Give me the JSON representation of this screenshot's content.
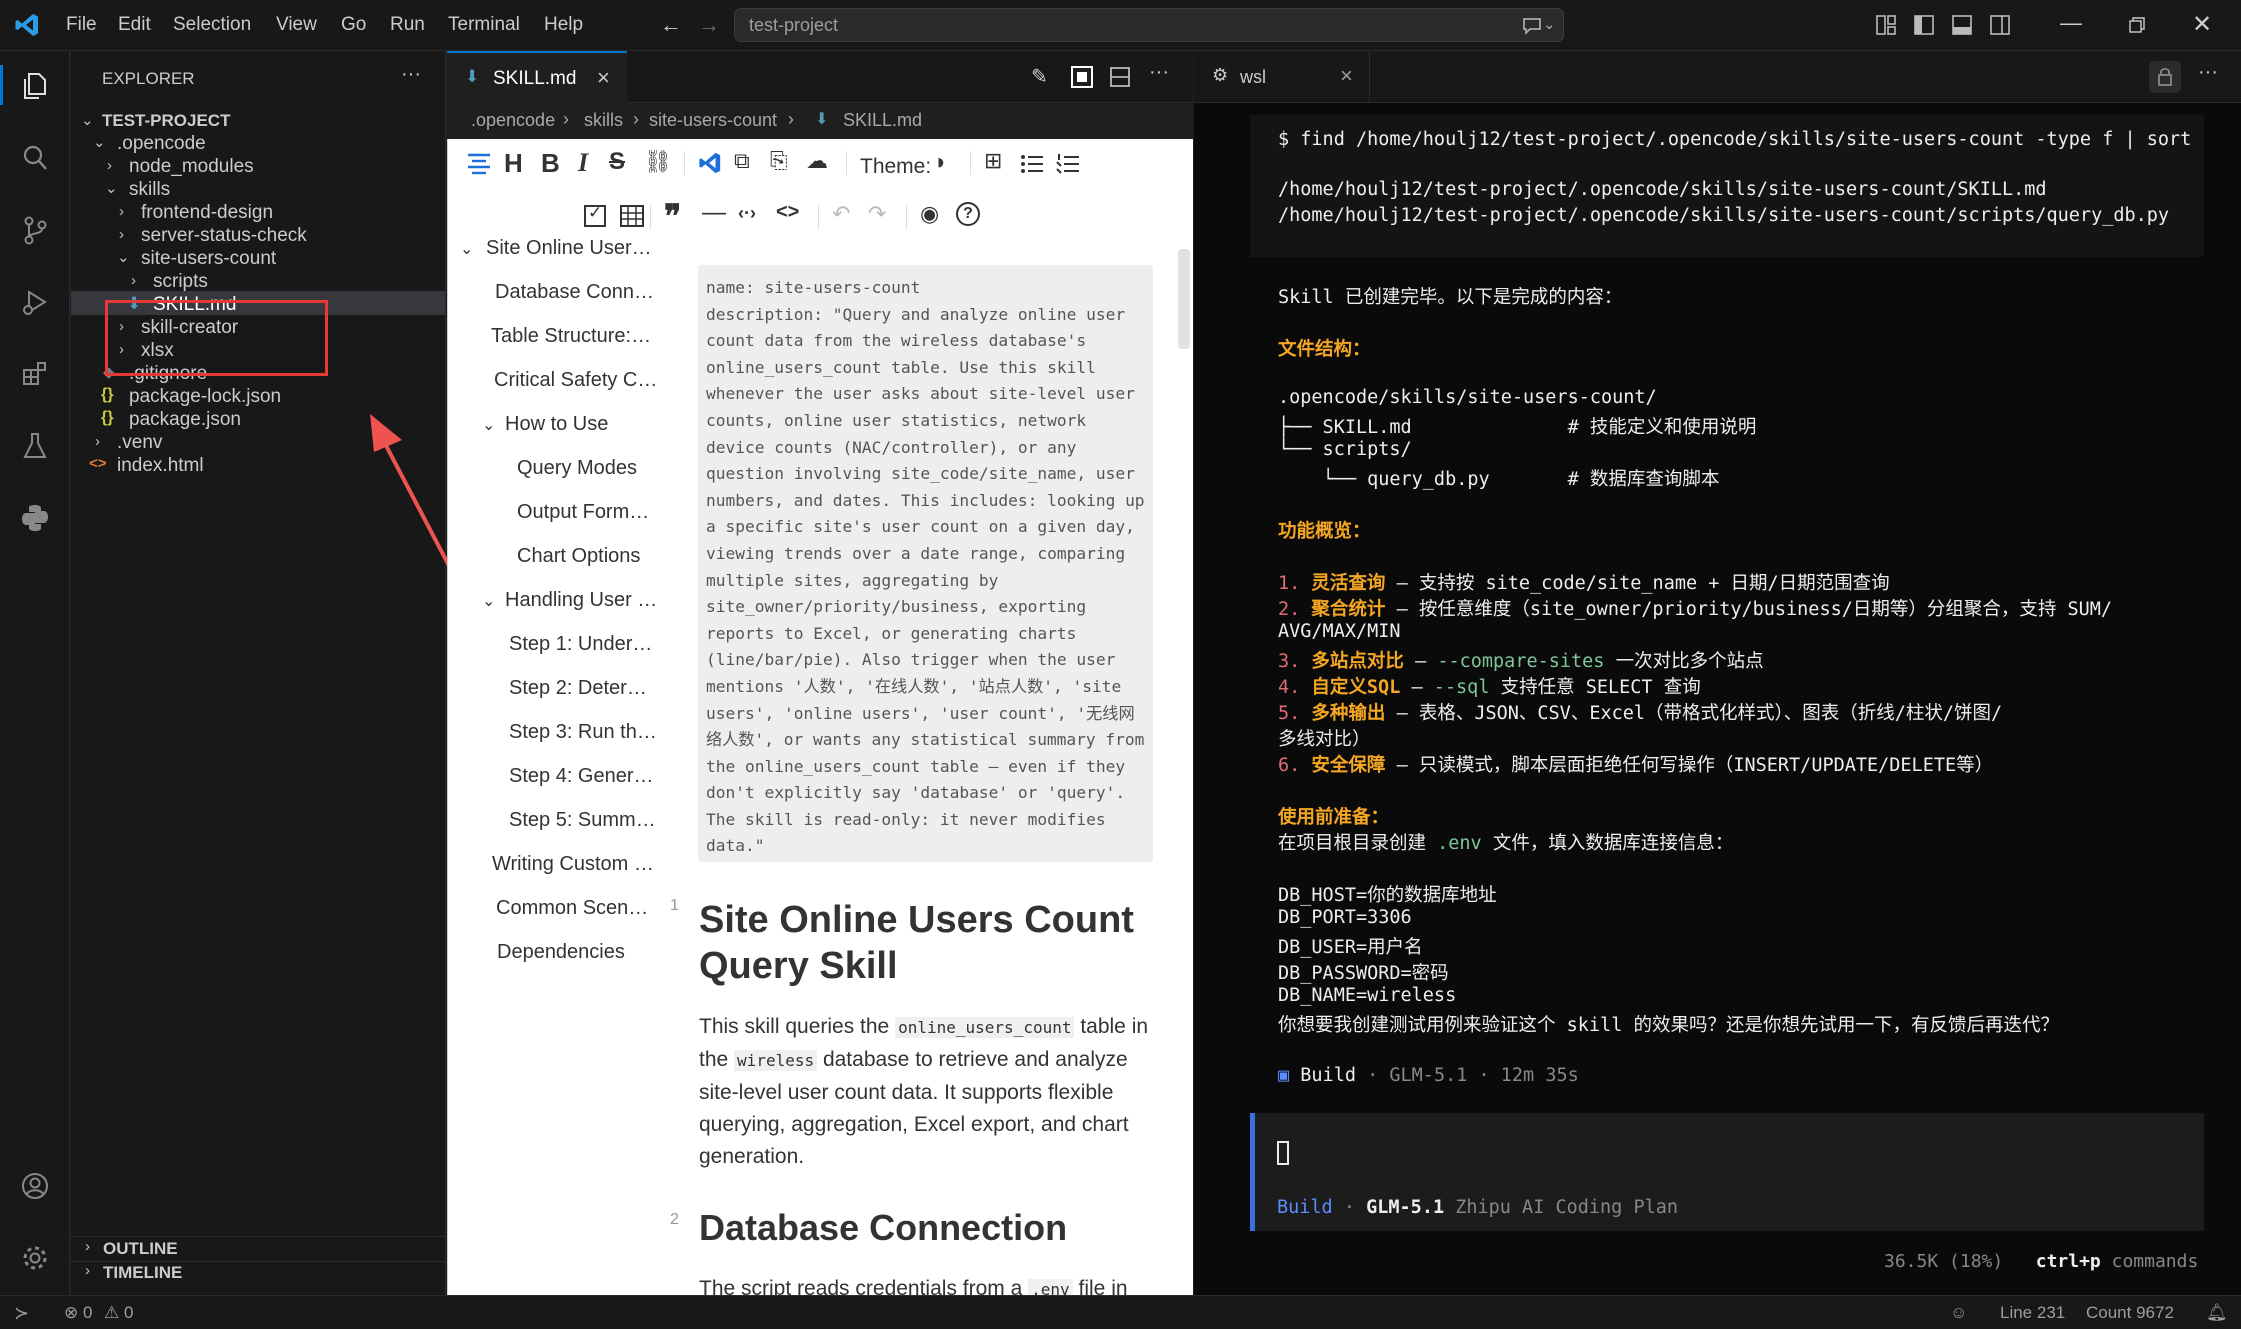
{
  "menu": [
    "File",
    "Edit",
    "Selection",
    "View",
    "Go",
    "Run",
    "Terminal",
    "Help"
  ],
  "search": {
    "text": "test-project"
  },
  "explorer": {
    "title": "EXPLORER",
    "root": "TEST-PROJECT",
    "items": [
      ".opencode",
      "node_modules",
      "skills",
      "frontend-design",
      "server-status-check",
      "site-users-count",
      "scripts",
      "SKILL.md",
      "skill-creator",
      "xlsx",
      ".gitignore",
      "package-lock.json",
      "package.json",
      ".venv",
      "index.html"
    ],
    "outline": "OUTLINE",
    "timeline": "TIMELINE"
  },
  "editor": {
    "tab": "SKILL.md",
    "breadcrumb": [
      ".opencode",
      "skills",
      "site-users-count",
      "SKILL.md"
    ],
    "theme_label": "Theme:",
    "toc": [
      "Site Online User…",
      "Database Conn…",
      "Table Structure:…",
      "Critical Safety C…",
      "How to Use",
      "Query Modes",
      "Output Form…",
      "Chart Options",
      "Handling User …",
      "Step 1: Under…",
      "Step 2: Deter…",
      "Step 3: Run th…",
      "Step 4: Gener…",
      "Step 5: Summ…",
      "Writing Custom …",
      "Common Scen…",
      "Dependencies"
    ],
    "frontmatter": "name: site-users-count\ndescription: \"Query and analyze online user count data from the wireless database's online_users_count table. Use this skill whenever the user asks about site-level user counts, online user statistics, network device counts (NAC/controller), or any question involving site_code/site_name, user numbers, and dates. This includes: looking up a specific site's user count on a given day, viewing trends over a date range, comparing multiple sites, aggregating by site_owner/priority/business, exporting reports to Excel, or generating charts (line/bar/pie). Also trigger when the user mentions '人数', '在线人数', '站点人数', 'site users', 'online users', 'user count', '无线网络人数', or wants any statistical summary from the online_users_count table — even if they don't explicitly say 'database' or 'query'. The skill is read-only: it never modifies data.\"",
    "line1": "1",
    "h1": "Site Online Users Count Query Skill",
    "para_a": "This skill queries the",
    "code_a": "online_users_count",
    "para_b": "table in the",
    "code_b": "wireless",
    "para_c": "database to retrieve and analyze site-level user count data. It supports flexible querying, aggregation, Excel export, and chart generation.",
    "line2": "2",
    "h2": "Database Connection",
    "para2_a": "The script reads credentials from a",
    "code_c": ".env",
    "para2_b": "file in"
  },
  "terminal": {
    "tab": "wsl",
    "cmd": "$ find /home/houlj12/test-project/.opencode/skills/site-users-count -type f | sort",
    "out1": "/home/houlj12/test-project/.opencode/skills/site-users-count/SKILL.md",
    "out2": "/home/houlj12/test-project/.opencode/skills/site-users-count/scripts/query_db.py",
    "done": "Skill 已创建完毕。以下是完成的内容：",
    "h_struct": "文件结构：",
    "tree1": ".opencode/skills/site-users-count/",
    "tree2": "├── SKILL.md              # 技能定义和使用说明",
    "tree3": "└── scripts/",
    "tree4": "    └── query_db.py       # 数据库查询脚本",
    "h_func": "功能概览：",
    "f1n": "1.",
    "f1h": "灵活查询",
    "f1t": " — 支持按 site_code/site_name + 日期/日期范围查询",
    "f2n": "2.",
    "f2h": "聚合统计",
    "f2t": " — 按任意维度（site_owner/priority/business/日期等）分组聚合，支持 SUM/",
    "f2c": "AVG/MAX/MIN",
    "f3n": "3.",
    "f3h": "多站点对比",
    "f3a": " — ",
    "f3g": "--compare-sites",
    "f3t": " 一次对比多个站点",
    "f4n": "4.",
    "f4h": "自定义SQL",
    "f4a": " — ",
    "f4g": "--sql",
    "f4t": " 支持任意 SELECT 查询",
    "f5n": "5.",
    "f5h": "多种输出",
    "f5t": " — 表格、JSON、CSV、Excel（带格式化样式）、图表（折线/柱状/饼图/",
    "f5c": "多线对比）",
    "f6n": "6.",
    "f6h": "安全保障",
    "f6t": " — 只读模式，脚本层面拒绝任何写操作（INSERT/UPDATE/DELETE等）",
    "h_prep": "使用前准备：",
    "prep_a": "在项目根目录创建 ",
    "prep_g": ".env",
    "prep_b": " 文件，填入数据库连接信息：",
    "env1": "DB_HOST=你的数据库地址",
    "env2": "DB_PORT=3306",
    "env3": "DB_USER=用户名",
    "env4": "DB_PASSWORD=密码",
    "env5": "DB_NAME=wireless",
    "ask": "你想要我创建测试用例来验证这个 skill 的效果吗？还是你想先试用一下，有反馈后再迭代？",
    "build_label": "Build",
    "build_meta": " · GLM-5.1 · 12m 35s",
    "input_mode": "Build",
    "input_model": "GLM-5.1",
    "input_plan": "Zhipu AI Coding Plan",
    "usage": "36.5K (18%)",
    "shortcut": "ctrl+p",
    "shortcut_label": "commands"
  },
  "status": {
    "errors": "0",
    "warnings": "0",
    "line": "Line 231",
    "count": "Count 9672"
  },
  "colors": {
    "accent": "#0078d4",
    "highlight_box": "#e53935",
    "terminal_heading": "#f5a623"
  }
}
